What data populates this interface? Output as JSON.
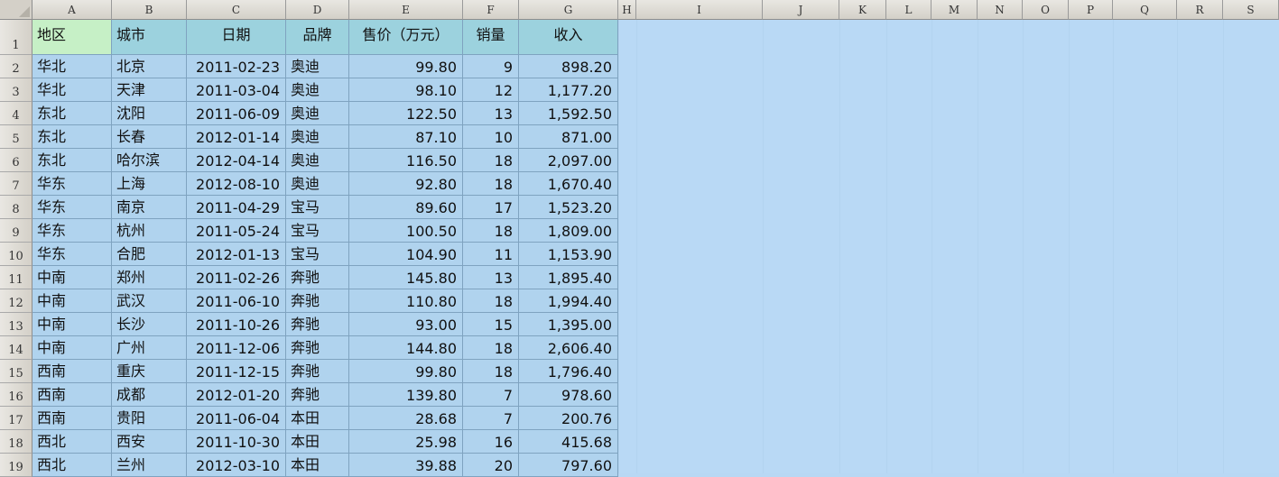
{
  "app": {
    "window_title": ""
  },
  "columns": [
    "A",
    "B",
    "C",
    "D",
    "E",
    "F",
    "G",
    "H",
    "I",
    "J",
    "K",
    "L",
    "M",
    "N",
    "O",
    "P",
    "Q",
    "R",
    "S"
  ],
  "row_numbers": [
    "1",
    "2",
    "3",
    "4",
    "5",
    "6",
    "7",
    "8",
    "9",
    "10",
    "11",
    "12",
    "13",
    "14",
    "15",
    "16",
    "17",
    "18",
    "19"
  ],
  "table": {
    "headers": [
      "地区",
      "城市",
      "日期",
      "品牌",
      "售价（万元）",
      "销量",
      "收入"
    ],
    "rows": [
      [
        "华北",
        "北京",
        "2011-02-23",
        "奥迪",
        "99.80",
        "9",
        "898.20"
      ],
      [
        "华北",
        "天津",
        "2011-03-04",
        "奥迪",
        "98.10",
        "12",
        "1,177.20"
      ],
      [
        "东北",
        "沈阳",
        "2011-06-09",
        "奥迪",
        "122.50",
        "13",
        "1,592.50"
      ],
      [
        "东北",
        "长春",
        "2012-01-14",
        "奥迪",
        "87.10",
        "10",
        "871.00"
      ],
      [
        "东北",
        "哈尔滨",
        "2012-04-14",
        "奥迪",
        "116.50",
        "18",
        "2,097.00"
      ],
      [
        "华东",
        "上海",
        "2012-08-10",
        "奥迪",
        "92.80",
        "18",
        "1,670.40"
      ],
      [
        "华东",
        "南京",
        "2011-04-29",
        "宝马",
        "89.60",
        "17",
        "1,523.20"
      ],
      [
        "华东",
        "杭州",
        "2011-05-24",
        "宝马",
        "100.50",
        "18",
        "1,809.00"
      ],
      [
        "华东",
        "合肥",
        "2012-01-13",
        "宝马",
        "104.90",
        "11",
        "1,153.90"
      ],
      [
        "中南",
        "郑州",
        "2011-02-26",
        "奔驰",
        "145.80",
        "13",
        "1,895.40"
      ],
      [
        "中南",
        "武汉",
        "2011-06-10",
        "奔驰",
        "110.80",
        "18",
        "1,994.40"
      ],
      [
        "中南",
        "长沙",
        "2011-10-26",
        "奔驰",
        "93.00",
        "15",
        "1,395.00"
      ],
      [
        "中南",
        "广州",
        "2011-12-06",
        "奔驰",
        "144.80",
        "18",
        "2,606.40"
      ],
      [
        "西南",
        "重庆",
        "2011-12-15",
        "奔驰",
        "99.80",
        "18",
        "1,796.40"
      ],
      [
        "西南",
        "成都",
        "2012-01-20",
        "奔驰",
        "139.80",
        "7",
        "978.60"
      ],
      [
        "西南",
        "贵阳",
        "2011-06-04",
        "本田",
        "28.68",
        "7",
        "200.76"
      ],
      [
        "西北",
        "西安",
        "2011-10-30",
        "本田",
        "25.98",
        "16",
        "415.68"
      ],
      [
        "西北",
        "兰州",
        "2012-03-10",
        "本田",
        "39.88",
        "20",
        "797.60"
      ]
    ]
  },
  "colors": {
    "header_fill": "#9cd2de",
    "active_header_fill": "#c6f0c6",
    "data_fill": "#b0d3ee",
    "background": "#b9d9f5",
    "grid_line": "#7fa3c0"
  }
}
